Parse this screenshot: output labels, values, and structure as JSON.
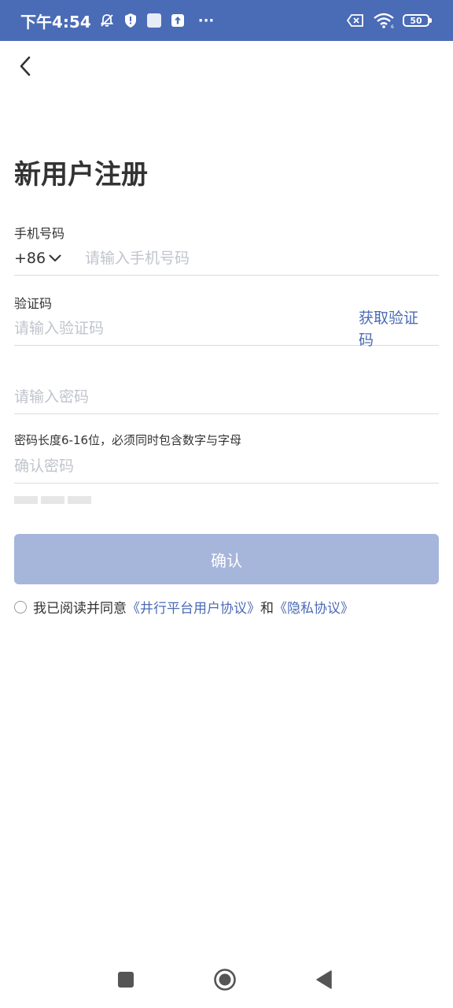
{
  "status_bar": {
    "time": "下午4:54",
    "battery": "50",
    "more": "···",
    "bg_color": "#4a6bb6"
  },
  "header": {
    "back_icon": "chevron-left-icon",
    "title": "新用户注册"
  },
  "phone": {
    "label": "手机号码",
    "country_code": "+86",
    "placeholder": "请输入手机号码",
    "value": ""
  },
  "code": {
    "label": "验证码",
    "placeholder": "请输入验证码",
    "value": "",
    "get_code_label": "获取验证码"
  },
  "password": {
    "placeholder": "请输入密码",
    "value": "",
    "hint": "密码长度6-16位，必须同时包含数字与字母"
  },
  "confirm_password": {
    "placeholder": "确认密码",
    "value": ""
  },
  "confirm_button": {
    "label": "确认",
    "color": "#a6b5da"
  },
  "agreement": {
    "prefix": "我已阅读并同意",
    "terms_link": "《井行平台用户协议》",
    "conjunction": "和",
    "privacy_link": "《隐私协议》",
    "link_color": "#4a6bb6",
    "checked": false
  },
  "nav_bar": {
    "recent": "square-icon",
    "home": "circle-icon",
    "back": "triangle-back-icon"
  }
}
